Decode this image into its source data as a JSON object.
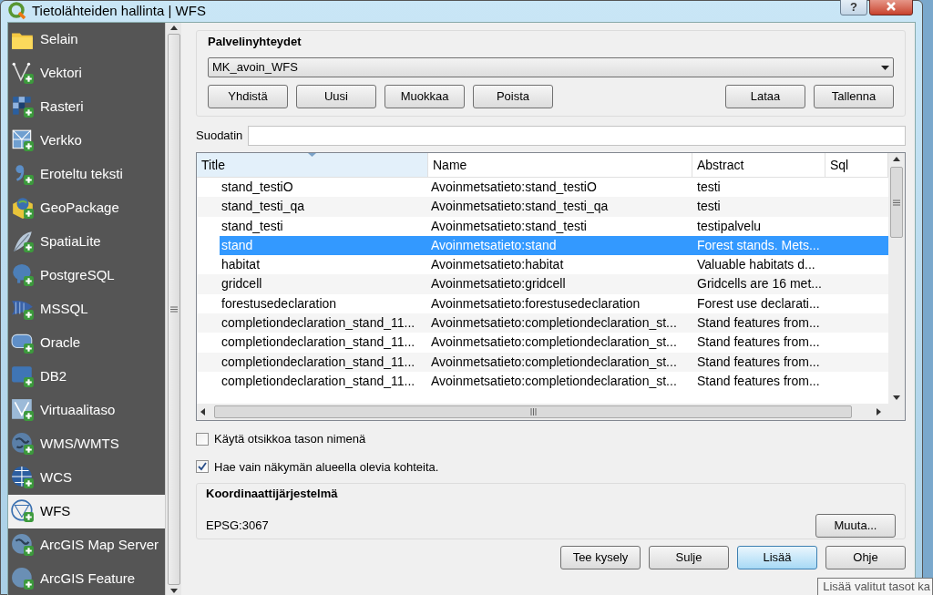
{
  "window": {
    "title": "Tietolähteiden hallinta | WFS",
    "help_button": "?"
  },
  "sidebar": {
    "items": [
      {
        "label": "Selain",
        "selected": false
      },
      {
        "label": "Vektori",
        "selected": false
      },
      {
        "label": "Rasteri",
        "selected": false
      },
      {
        "label": "Verkko",
        "selected": false
      },
      {
        "label": "Eroteltu teksti",
        "selected": false
      },
      {
        "label": "GeoPackage",
        "selected": false
      },
      {
        "label": "SpatiaLite",
        "selected": false
      },
      {
        "label": "PostgreSQL",
        "selected": false
      },
      {
        "label": "MSSQL",
        "selected": false
      },
      {
        "label": "Oracle",
        "selected": false
      },
      {
        "label": "DB2",
        "selected": false
      },
      {
        "label": "Virtuaalitaso",
        "selected": false
      },
      {
        "label": "WMS/WMTS",
        "selected": false
      },
      {
        "label": "WCS",
        "selected": false
      },
      {
        "label": "WFS",
        "selected": true
      },
      {
        "label": "ArcGIS Map Server",
        "selected": false
      },
      {
        "label": "ArcGIS Feature",
        "selected": false
      }
    ]
  },
  "connections": {
    "title": "Palvelinyhteydet",
    "connection": "MK_avoin_WFS",
    "left_buttons": [
      "Yhdistä",
      "Uusi",
      "Muokkaa",
      "Poista"
    ],
    "right_buttons": [
      "Lataa",
      "Tallenna"
    ]
  },
  "filter": {
    "label": "Suodatin"
  },
  "table": {
    "columns": [
      "Title",
      "Name",
      "Abstract",
      "Sql"
    ],
    "rows": [
      {
        "cells": [
          "stand_testiO",
          "Avoinmetsatieto:stand_testiO",
          "testi"
        ],
        "selected": false
      },
      {
        "cells": [
          "stand_testi_qa",
          "Avoinmetsatieto:stand_testi_qa",
          "testi"
        ],
        "selected": false
      },
      {
        "cells": [
          "stand_testi",
          "Avoinmetsatieto:stand_testi",
          "testipalvelu"
        ],
        "selected": false
      },
      {
        "cells": [
          "stand",
          "Avoinmetsatieto:stand",
          "Forest stands. Mets..."
        ],
        "selected": true
      },
      {
        "cells": [
          "habitat",
          "Avoinmetsatieto:habitat",
          "Valuable habitats d..."
        ],
        "selected": false
      },
      {
        "cells": [
          "gridcell",
          "Avoinmetsatieto:gridcell",
          "Gridcells are 16 met..."
        ],
        "selected": false
      },
      {
        "cells": [
          "forestusedeclaration",
          "Avoinmetsatieto:forestusedeclaration",
          "Forest use declarati..."
        ],
        "selected": false
      },
      {
        "cells": [
          "completiondeclaration_stand_11...",
          "Avoinmetsatieto:completiondeclaration_st...",
          "Stand features from..."
        ],
        "selected": false
      },
      {
        "cells": [
          "completiondeclaration_stand_11...",
          "Avoinmetsatieto:completiondeclaration_st...",
          "Stand features from..."
        ],
        "selected": false
      },
      {
        "cells": [
          "completiondeclaration_stand_11...",
          "Avoinmetsatieto:completiondeclaration_st...",
          "Stand features from..."
        ],
        "selected": false
      },
      {
        "cells": [
          "completiondeclaration_stand_11...",
          "Avoinmetsatieto:completiondeclaration_st...",
          "Stand features from..."
        ],
        "selected": false
      }
    ]
  },
  "options": [
    {
      "label": "Käytä otsikkoa tason nimenä",
      "checked": false
    },
    {
      "label": "Hae vain näkymän alueella olevia kohteita.",
      "checked": true
    }
  ],
  "crs": {
    "title": "Koordinaattijärjestelmä",
    "value": "EPSG:3067",
    "button": "Muuta..."
  },
  "dialog_buttons": [
    {
      "label": "Tee kysely",
      "hovered": false
    },
    {
      "label": "Sulje",
      "hovered": false
    },
    {
      "label": "Lisää",
      "hovered": true
    },
    {
      "label": "Ohje",
      "hovered": false
    }
  ],
  "tooltip": "Lisää valitut tasot ka"
}
